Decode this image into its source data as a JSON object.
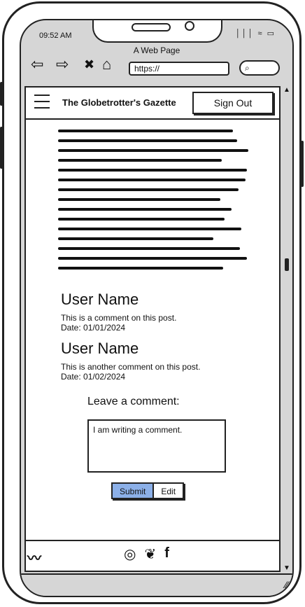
{
  "status": {
    "time": "09:52 AM",
    "icons": "│││ ≈ ▭"
  },
  "browser": {
    "title": "A Web Page",
    "url": "https://",
    "back_icon": "⇦",
    "forward_icon": "⇨",
    "close_icon": "✖",
    "home_icon": "⌂",
    "search_icon": "⌕"
  },
  "header": {
    "title": "The Globetrotter's Gazette",
    "sign_out_label": "Sign Out"
  },
  "article": {
    "scribble_lines": 15
  },
  "comments": [
    {
      "user": "User Name",
      "text": "This is a comment on this post.",
      "date": "Date: 01/01/2024"
    },
    {
      "user": "User Name",
      "text": "This is another comment on this post.",
      "date": "Date: 01/02/2024"
    }
  ],
  "comment_form": {
    "heading": "Leave a comment:",
    "value": "I am writing a comment.",
    "submit_label": "Submit",
    "edit_label": "Edit"
  },
  "footer": {
    "logo_glyph": "〰",
    "social": [
      "◎",
      "❦",
      "f"
    ]
  },
  "colors": {
    "accent": "#8cb0e8"
  }
}
